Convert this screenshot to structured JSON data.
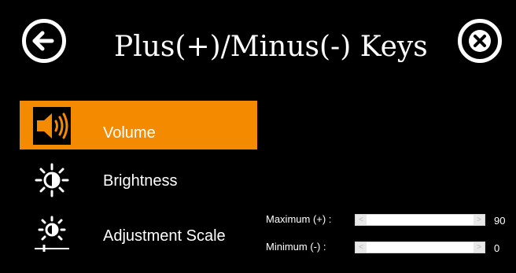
{
  "header": {
    "title": "Plus(+)/Minus(-) Keys",
    "back_icon": "arrow-left-circle-icon",
    "close_icon": "close-circle-icon"
  },
  "menu": {
    "items": [
      {
        "label": "Volume",
        "icon": "speaker-icon",
        "active": true
      },
      {
        "label": "Brightness",
        "icon": "brightness-icon",
        "active": false
      },
      {
        "label": "Adjustment Scale",
        "icon": "adjustment-scale-icon",
        "active": false
      }
    ]
  },
  "sliders": {
    "maximum": {
      "label": "Maximum (+) :",
      "value": "90"
    },
    "minimum": {
      "label": "Minimum (-) :",
      "value": "0"
    }
  },
  "colors": {
    "accent": "#f48a00",
    "background": "#000000"
  }
}
